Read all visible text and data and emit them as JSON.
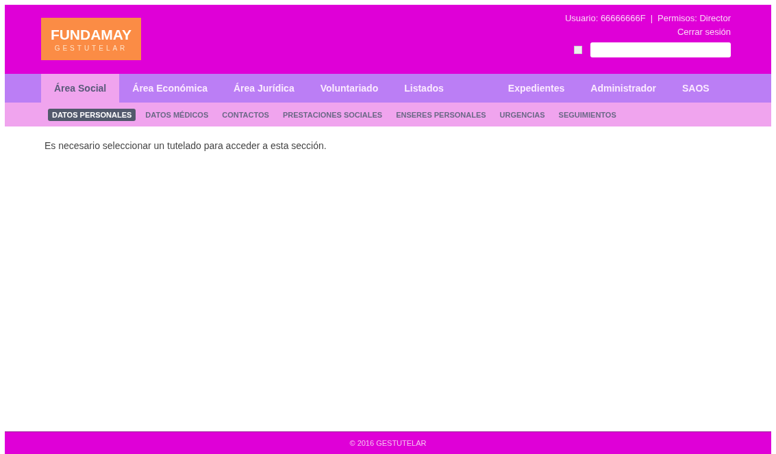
{
  "logo": {
    "title": "FUNDAMAY",
    "subtitle": "GESTUTELAR"
  },
  "user_info": {
    "user": "Usuario: 66666666F",
    "separator": "|",
    "permissions": "Permisos: Director",
    "logout": "Cerrar sesión"
  },
  "search": {
    "checked": false
  },
  "nav": {
    "left": [
      {
        "label": "Área Social",
        "selected": true
      },
      {
        "label": "Área Económica",
        "selected": false
      },
      {
        "label": "Área Jurídica",
        "selected": false
      },
      {
        "label": "Voluntariado",
        "selected": false
      },
      {
        "label": "Listados",
        "selected": false
      }
    ],
    "right": [
      {
        "label": "Expedientes",
        "selected": false
      },
      {
        "label": "Administrador",
        "selected": false
      },
      {
        "label": "SAOS",
        "selected": false
      }
    ]
  },
  "subnav": [
    {
      "label": "DATOS PERSONALES",
      "selected": true
    },
    {
      "label": "DATOS MÉDICOS",
      "selected": false
    },
    {
      "label": "CONTACTOS",
      "selected": false
    },
    {
      "label": "PRESTACIONES SOCIALES",
      "selected": false
    },
    {
      "label": "ENSERES PERSONALES",
      "selected": false
    },
    {
      "label": "URGENCIAS",
      "selected": false
    },
    {
      "label": "SEGUIMIENTOS",
      "selected": false
    }
  ],
  "message": "Es necesario seleccionar un tutelado para acceder a esta sección.",
  "footer": "© 2016 GESTUTELAR"
}
